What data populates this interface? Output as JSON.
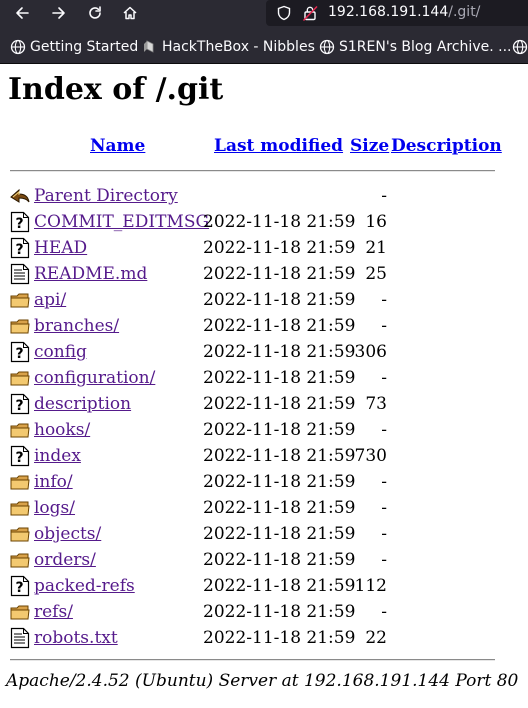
{
  "browser": {
    "url_host": "192.168.191.144",
    "url_path": "/.git/",
    "bookmarks": [
      {
        "label": "Getting Started",
        "icon": "globe-icon"
      },
      {
        "label": "HackTheBox - Nibbles",
        "icon": "bookmark-favicon"
      },
      {
        "label": "S1REN's Blog Archive. ...",
        "icon": "globe-icon"
      }
    ]
  },
  "page": {
    "title": "Index of /.git",
    "columns": {
      "name": "Name",
      "modified": "Last modified",
      "size": "Size",
      "description": "Description"
    },
    "entries": [
      {
        "name": "Parent Directory",
        "modified": "",
        "size": "-",
        "icon": "back-arrow-icon"
      },
      {
        "name": "COMMIT_EDITMSG",
        "modified": "2022-11-18 21:59",
        "size": "16",
        "icon": "unknown-file-icon"
      },
      {
        "name": "HEAD",
        "modified": "2022-11-18 21:59",
        "size": "21",
        "icon": "unknown-file-icon"
      },
      {
        "name": "README.md",
        "modified": "2022-11-18 21:59",
        "size": "25",
        "icon": "text-file-icon"
      },
      {
        "name": "api/",
        "modified": "2022-11-18 21:59",
        "size": "-",
        "icon": "folder-icon"
      },
      {
        "name": "branches/",
        "modified": "2022-11-18 21:59",
        "size": "-",
        "icon": "folder-icon"
      },
      {
        "name": "config",
        "modified": "2022-11-18 21:59",
        "size": "306",
        "icon": "unknown-file-icon"
      },
      {
        "name": "configuration/",
        "modified": "2022-11-18 21:59",
        "size": "-",
        "icon": "folder-icon"
      },
      {
        "name": "description",
        "modified": "2022-11-18 21:59",
        "size": "73",
        "icon": "unknown-file-icon"
      },
      {
        "name": "hooks/",
        "modified": "2022-11-18 21:59",
        "size": "-",
        "icon": "folder-icon"
      },
      {
        "name": "index",
        "modified": "2022-11-18 21:59",
        "size": "730",
        "icon": "unknown-file-icon"
      },
      {
        "name": "info/",
        "modified": "2022-11-18 21:59",
        "size": "-",
        "icon": "folder-icon"
      },
      {
        "name": "logs/",
        "modified": "2022-11-18 21:59",
        "size": "-",
        "icon": "folder-icon"
      },
      {
        "name": "objects/",
        "modified": "2022-11-18 21:59",
        "size": "-",
        "icon": "folder-icon"
      },
      {
        "name": "orders/",
        "modified": "2022-11-18 21:59",
        "size": "-",
        "icon": "folder-icon"
      },
      {
        "name": "packed-refs",
        "modified": "2022-11-18 21:59",
        "size": "112",
        "icon": "unknown-file-icon"
      },
      {
        "name": "refs/",
        "modified": "2022-11-18 21:59",
        "size": "-",
        "icon": "folder-icon"
      },
      {
        "name": "robots.txt",
        "modified": "2022-11-18 21:59",
        "size": "22",
        "icon": "text-file-icon"
      }
    ],
    "footer": "Apache/2.4.52 (Ubuntu) Server at 192.168.191.144 Port 80"
  },
  "colors": {
    "link": "#551a8b",
    "header_link": "#0000ee",
    "chrome": "#2b2a33",
    "urlbar": "#1c1b22"
  }
}
